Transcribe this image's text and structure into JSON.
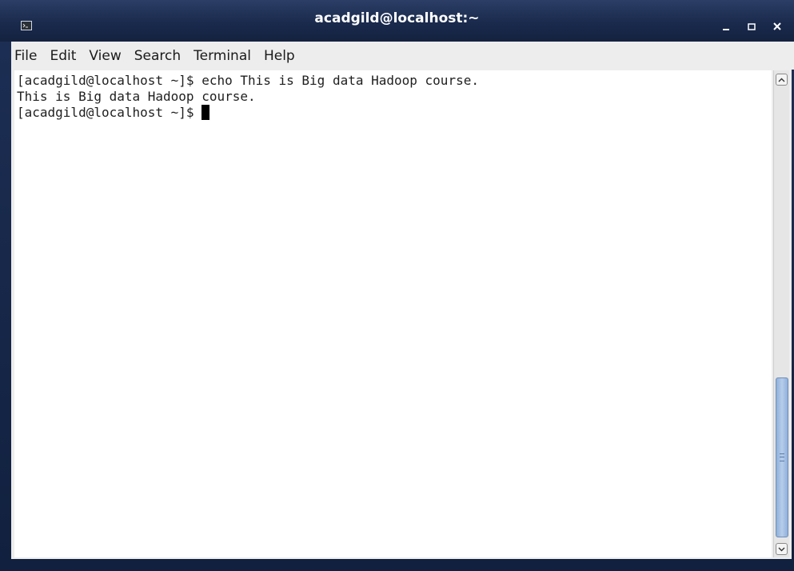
{
  "window": {
    "title": "acadgild@localhost:~",
    "controls": {
      "minimize": "minimize-icon",
      "maximize": "maximize-icon",
      "close": "close-icon"
    }
  },
  "menu": {
    "items": [
      "File",
      "Edit",
      "View",
      "Search",
      "Terminal",
      "Help"
    ]
  },
  "terminal": {
    "lines": [
      "[acadgild@localhost ~]$ echo This is Big data Hadoop course.",
      "This is Big data Hadoop course.",
      "[acadgild@localhost ~]$ "
    ]
  },
  "colors": {
    "titlebar": "#1a2a4d",
    "terminal_bg": "#ffffff",
    "terminal_fg": "#1f1f1f",
    "scroll_thumb": "#a4bfe3"
  }
}
